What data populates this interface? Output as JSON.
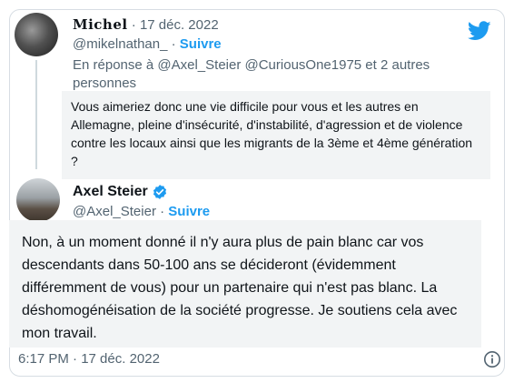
{
  "reply_tweet": {
    "display_name": "Michel",
    "date": "17 déc. 2022",
    "handle": "@mikelnathan_",
    "follow_label": "Suivre",
    "reply_to": "En réponse à @Axel_Steier @CuriousOne1975  et 2 autres personnes",
    "text": "Vous aimeriez donc une vie difficile pour vous et les autres en Allemagne, pleine d'insécurité, d'instabilité, d'agression et de violence contre les locaux ainsi que les migrants de la 3ème et 4ème génération ?"
  },
  "main_tweet": {
    "display_name": "Axel Steier",
    "handle": "@Axel_Steier",
    "follow_label": "Suivre",
    "text": "Non, à un moment donné il n'y aura plus de pain blanc car vos descendants dans 50-100 ans se décideront (évidemment différemment de vous) pour un partenaire qui n'est pas blanc. La déshomogénéisation de la société progresse. Je soutiens cela avec mon travail.",
    "timestamp": "6:17 PM · 17 déc. 2022"
  },
  "colors": {
    "accent": "#1d9bf0",
    "muted": "#536471",
    "highlight_bg": "#f2f4f5"
  },
  "icons": [
    "twitter-logo-icon",
    "verified-badge-icon",
    "info-icon"
  ]
}
